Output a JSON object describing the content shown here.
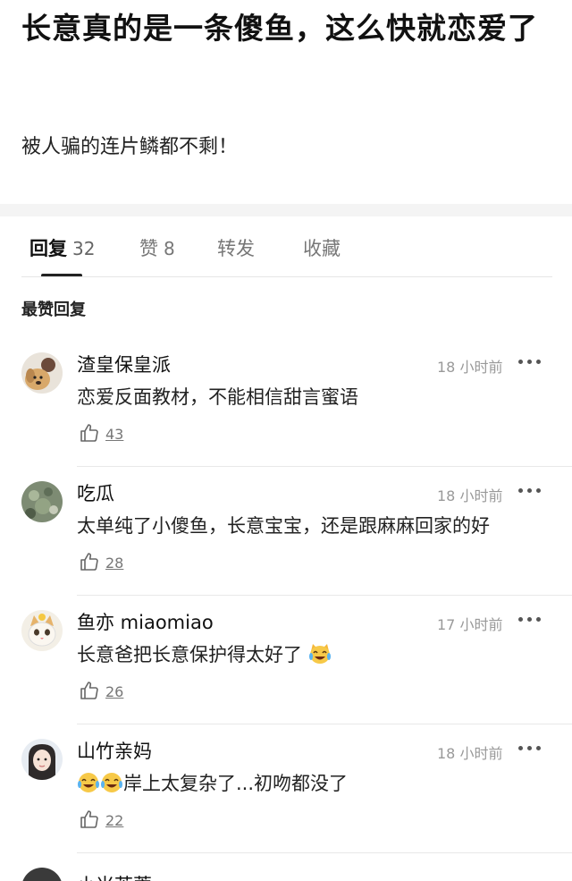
{
  "post": {
    "title": "长意真的是一条傻鱼，这么快就恋爱了",
    "body": "被人骗的连片鳞都不剩！"
  },
  "tabs": [
    {
      "label": "回复",
      "count": "32"
    },
    {
      "label": "赞",
      "count": "8"
    },
    {
      "label": "转发",
      "count": ""
    },
    {
      "label": "收藏",
      "count": ""
    }
  ],
  "section_label": "最赞回复",
  "comments": [
    {
      "username": "渣皇保皇派",
      "time": "18 小时前",
      "text": "恋爱反面教材，不能相信甜言蜜语",
      "likes": "43",
      "avatar_icon": "dog-avatar"
    },
    {
      "username": "吃瓜",
      "time": "18 小时前",
      "text": "太单纯了小傻鱼，长意宝宝，还是跟麻麻回家的好",
      "likes": "28",
      "avatar_icon": "plant-avatar"
    },
    {
      "username": "鱼亦 miaomiao",
      "time": "17 小时前",
      "text": "长意爸把长意保护得太好了",
      "likes": "26",
      "avatar_icon": "cat-avatar",
      "trailing_emoji": "crying-laughing-cat-emoji"
    },
    {
      "username": "山竹亲妈",
      "time": "18 小时前",
      "text": "岸上太复杂了...初吻都没了",
      "likes": "22",
      "avatar_icon": "girl-avatar",
      "leading_emoji": [
        "tears-of-joy-emoji",
        "tears-of-joy-emoji"
      ]
    }
  ],
  "partial_comment": {
    "username": "小米芙蓉"
  },
  "colors": {
    "accent": "#222222",
    "muted": "#999999",
    "divider": "#e8e8e8"
  }
}
